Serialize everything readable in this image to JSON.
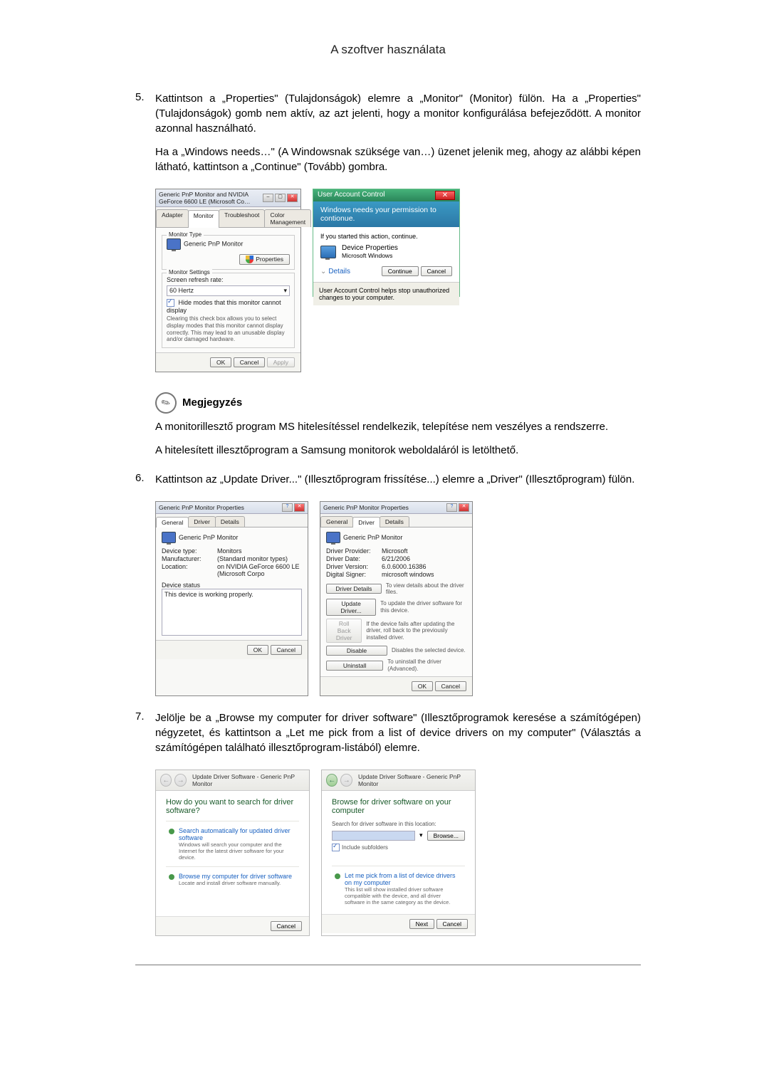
{
  "chapterTitle": "A szoftver használata",
  "step5": {
    "num": "5.",
    "para1": "Kattintson a „Properties\" (Tulajdonságok) elemre a „Monitor\" (Monitor) fülön. Ha a „Properties\" (Tulajdonságok) gomb nem aktív, az azt jelenti, hogy a monitor konfigurálása befejeződött. A monitor azonnal használható.",
    "para2": "Ha a „Windows needs…\" (A Windowsnak szüksége van…) üzenet jelenik meg, ahogy az alábbi képen látható, kattintson a „Continue\" (Tovább) gombra."
  },
  "dlgMonitorTab": {
    "title": "Generic PnP Monitor and NVIDIA GeForce 6600 LE (Microsoft Co…",
    "tabs": {
      "adapter": "Adapter",
      "monitor": "Monitor",
      "troubleshoot": "Troubleshoot",
      "colorMgmt": "Color Management"
    },
    "groupMonitorType": "Monitor Type",
    "monitorName": "Generic PnP Monitor",
    "propertiesBtn": "Properties",
    "groupMonitorSettings": "Monitor Settings",
    "refreshLabel": "Screen refresh rate:",
    "refreshValue": "60 Hertz",
    "hideModes": "Hide modes that this monitor cannot display",
    "hideModesDesc": "Clearing this check box allows you to select display modes that this monitor cannot display correctly. This may lead to an unusable display and/or damaged hardware.",
    "ok": "OK",
    "cancel": "Cancel",
    "apply": "Apply"
  },
  "uac": {
    "title": "User Account Control",
    "banner": "Windows needs your permission to contionue.",
    "started": "If you started this action, continue.",
    "progName": "Device Properties",
    "publisher": "Microsoft Windows",
    "detailsBtn": "Details",
    "continueBtn": "Continue",
    "cancelBtn": "Cancel",
    "footer": "User Account Control helps stop unauthorized changes to your computer."
  },
  "note": {
    "label": "Megjegyzés",
    "p1": "A monitorillesztő program MS hitelesítéssel rendelkezik, telepítése nem veszélyes a rendszerre.",
    "p2": "A hitelesített illesztőprogram a Samsung monitorok weboldaláról is letölthető."
  },
  "step6": {
    "num": "6.",
    "text": "Kattintson az „Update Driver...\" (Illesztőprogram frissítése...) elemre a „Driver\" (Illesztőprogram) fülön."
  },
  "dlgGeneral": {
    "title": "Generic PnP Monitor Properties",
    "tabs": {
      "general": "General",
      "driver": "Driver",
      "details": "Details"
    },
    "monitorName": "Generic PnP Monitor",
    "deviceTypeK": "Device type:",
    "deviceTypeV": "Monitors",
    "manufacturerK": "Manufacturer:",
    "manufacturerV": "(Standard monitor types)",
    "locationK": "Location:",
    "locationV": "on NVIDIA GeForce 6600 LE (Microsoft Corpo",
    "statusGroup": "Device status",
    "statusText": "This device is working properly.",
    "ok": "OK",
    "cancel": "Cancel"
  },
  "dlgDriver": {
    "title": "Generic PnP Monitor Properties",
    "tabs": {
      "general": "General",
      "driver": "Driver",
      "details": "Details"
    },
    "monitorName": "Generic PnP Monitor",
    "providerK": "Driver Provider:",
    "providerV": "Microsoft",
    "dateK": "Driver Date:",
    "dateV": "6/21/2006",
    "versionK": "Driver Version:",
    "versionV": "6.0.6000.16386",
    "signerK": "Digital Signer:",
    "signerV": "microsoft windows",
    "btnDetails": "Driver Details",
    "descDetails": "To view details about the driver files.",
    "btnUpdate": "Update Driver...",
    "descUpdate": "To update the driver software for this device.",
    "btnRollback": "Roll Back Driver",
    "descRollback": "If the device fails after updating the driver, roll back to the previously installed driver.",
    "btnDisable": "Disable",
    "descDisable": "Disables the selected device.",
    "btnUninstall": "Uninstall",
    "descUninstall": "To uninstall the driver (Advanced).",
    "ok": "OK",
    "cancel": "Cancel"
  },
  "step7": {
    "num": "7.",
    "text": "Jelölje be a „Browse my computer for driver software\" (Illesztőprogramok keresése a számítógépen) négyzetet, és kattintson a „Let me pick from a list of device drivers on my computer\" (Választás a számítógépen található illesztőprogram-listából) elemre."
  },
  "wiz1": {
    "breadcrumb": "Update Driver Software - Generic PnP Monitor",
    "heading": "How do you want to search for driver software?",
    "opt1Title": "Search automatically for updated driver software",
    "opt1Desc": "Windows will search your computer and the Internet for the latest driver software for your device.",
    "opt2Title": "Browse my computer for driver software",
    "opt2Desc": "Locate and install driver software manually.",
    "cancel": "Cancel"
  },
  "wiz2": {
    "breadcrumb": "Update Driver Software - Generic PnP Monitor",
    "heading": "Browse for driver software on your computer",
    "searchLabel": "Search for driver software in this location:",
    "browseBtn": "Browse...",
    "includeSub": "Include subfolders",
    "optTitle": "Let me pick from a list of device drivers on my computer",
    "optDesc": "This list will show installed driver software compatible with the device, and all driver software in the same category as the device.",
    "next": "Next",
    "cancel": "Cancel"
  }
}
